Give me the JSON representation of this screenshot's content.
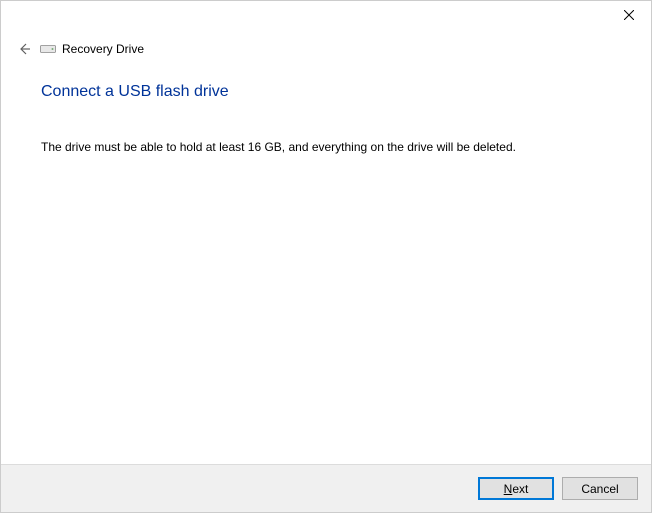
{
  "titlebar": {
    "close_label": "Close"
  },
  "header": {
    "wizard_title": "Recovery Drive"
  },
  "main": {
    "heading": "Connect a USB flash drive",
    "body": "The drive must be able to hold at least 16 GB, and everything on the drive will be deleted."
  },
  "footer": {
    "next_prefix": "",
    "next_accel": "N",
    "next_suffix": "ext",
    "cancel_label": "Cancel"
  }
}
